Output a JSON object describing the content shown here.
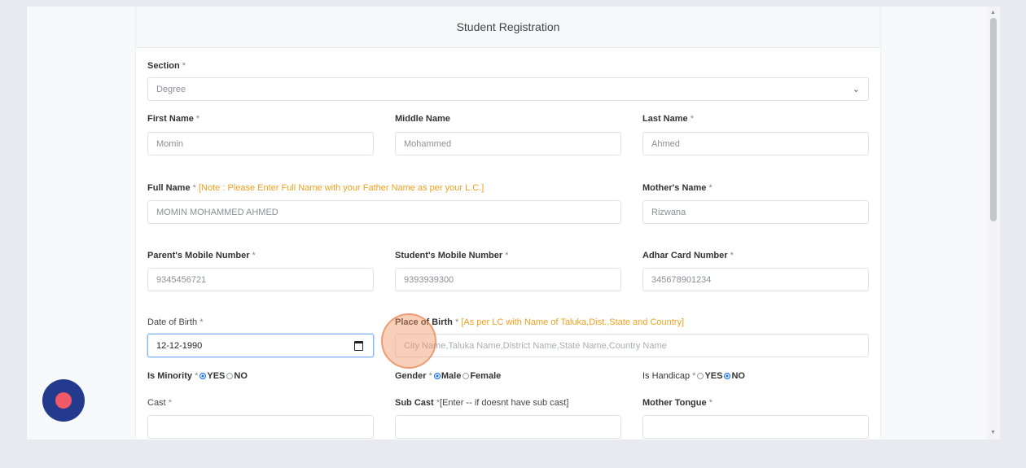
{
  "form": {
    "title": "Student Registration",
    "required_mark": "*",
    "section": {
      "label": "Section",
      "value": "Degree"
    },
    "first_name": {
      "label": "First Name",
      "value": "Momin"
    },
    "middle_name": {
      "label": "Middle Name",
      "value": "Mohammed"
    },
    "last_name": {
      "label": "Last Name",
      "value": "Ahmed"
    },
    "full_name": {
      "label": "Full Name",
      "note": "[Note : Please Enter Full Name with your Father Name as per your L.C.]",
      "value": "MOMIN MOHAMMED AHMED"
    },
    "mother_name": {
      "label": "Mother's Name",
      "value": "Rizwana"
    },
    "parent_mobile": {
      "label": "Parent's Mobile Number",
      "value": "9345456721"
    },
    "student_mobile": {
      "label": "Student's Mobile Number",
      "value": "9393939300"
    },
    "adhar": {
      "label": "Adhar Card Number",
      "value": "345678901234"
    },
    "dob": {
      "label": "Date of Birth",
      "value": "12-12-1990"
    },
    "place_of_birth": {
      "label": "Place of Birth",
      "note": "[As per LC with Name of Taluka,Dist.,State and Country]",
      "placeholder": "City Name,Taluka Name,District Name,State Name,Country Name"
    },
    "minority": {
      "label": "Is Minority",
      "yes": "YES",
      "no": "NO",
      "selected": "YES"
    },
    "gender": {
      "label": "Gender",
      "male": "Male",
      "female": "Female",
      "selected": "Male"
    },
    "handicap": {
      "label": "Is Handicap",
      "yes": "YES",
      "no": "NO",
      "selected": "NO"
    },
    "cast": {
      "label": "Cast"
    },
    "sub_cast": {
      "label": "Sub Cast",
      "note": "[Enter -- if doesnt have sub cast]"
    },
    "mother_tongue": {
      "label": "Mother Tongue"
    }
  },
  "icons": {
    "calendar": "calendar-icon",
    "chevron": "chevron-down-icon",
    "record": "record-icon"
  },
  "colors": {
    "accent": "#0d6efd",
    "note": "#f0a020",
    "record_button": "#243a8c",
    "record_dot": "#f05a68"
  }
}
